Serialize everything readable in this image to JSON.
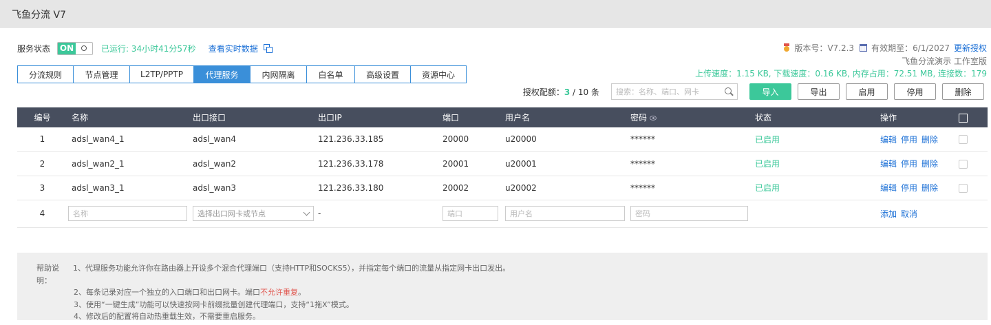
{
  "window": {
    "title": "飞鱼分流 V7"
  },
  "status": {
    "label": "服务状态",
    "toggle_on": "ON",
    "running": "已运行: 34小时41分57秒",
    "realtime_link": "查看实时数据"
  },
  "tabs": [
    {
      "label": "分流规则"
    },
    {
      "label": "节点管理"
    },
    {
      "label": "L2TP/PPTP"
    },
    {
      "label": "代理服务",
      "active": true
    },
    {
      "label": "内网隔离"
    },
    {
      "label": "白名单"
    },
    {
      "label": "高级设置"
    },
    {
      "label": "资源中心"
    }
  ],
  "info": {
    "version": "版本号：V7.2.3",
    "expiry": "有效期至：6/1/2027",
    "renew": "更新授权",
    "edition": "飞鱼分流演示 工作室版",
    "stats": "上传速度：1.15 KB, 下载速度：0.16 KB, 内存占用：72.51 MB, 连接数：179"
  },
  "quota": {
    "label": "授权配额：",
    "current": "3",
    "rest": " / 10 条"
  },
  "search": {
    "placeholder": "搜索：名称、端口、网卡"
  },
  "buttons": {
    "import": "导入",
    "export": "导出",
    "enable": "启用",
    "disable": "停用",
    "delete": "删除"
  },
  "columns": {
    "no": "编号",
    "name": "名称",
    "iface": "出口接口",
    "ip": "出口IP",
    "port": "端口",
    "user": "用户名",
    "password": "密码",
    "status": "状态",
    "ops": "操作"
  },
  "rows": [
    {
      "no": "1",
      "name": "adsl_wan4_1",
      "iface": "adsl_wan4",
      "ip": "121.236.33.185",
      "port": "20000",
      "user": "u20000",
      "password": "******",
      "status": "已启用",
      "edit": "编辑",
      "disable": "停用",
      "delete": "删除"
    },
    {
      "no": "2",
      "name": "adsl_wan2_1",
      "iface": "adsl_wan2",
      "ip": "121.236.33.178",
      "port": "20001",
      "user": "u20001",
      "password": "******",
      "status": "已启用",
      "edit": "编辑",
      "disable": "停用",
      "delete": "删除"
    },
    {
      "no": "3",
      "name": "adsl_wan3_1",
      "iface": "adsl_wan3",
      "ip": "121.236.33.180",
      "port": "20002",
      "user": "u20002",
      "password": "******",
      "status": "已启用",
      "edit": "编辑",
      "disable": "停用",
      "delete": "删除"
    }
  ],
  "add_row": {
    "no": "4",
    "name_ph": "名称",
    "iface_ph": "选择出口网卡或节点",
    "ip": "-",
    "port_ph": "端口",
    "user_ph": "用户名",
    "password_ph": "密码",
    "add": "添加",
    "cancel": "取消"
  },
  "help": {
    "lead": "帮助说明：",
    "line1": "1、代理服务功能允许你在路由器上开设多个混合代理端口（支持HTTP和SOCKS5），并指定每个端口的流量从指定网卡出口发出。",
    "line2_a": "2、每条记录对应一个独立的入口端口和出口网卡。端口",
    "line2_b": "不允许重复",
    "line2_c": "。",
    "line3": "3、使用“一键生成”功能可以快速按网卡前缀批量创建代理端口，支持“1拖X”模式。",
    "line4": "4、修改后的配置将自动热重载生效，不需要重启服务。"
  },
  "colors": {
    "accent": "#3cc89a",
    "tab": "#3a8fd9",
    "header": "#474e5e",
    "link": "#1a6fd6",
    "warn": "#e0524a"
  }
}
